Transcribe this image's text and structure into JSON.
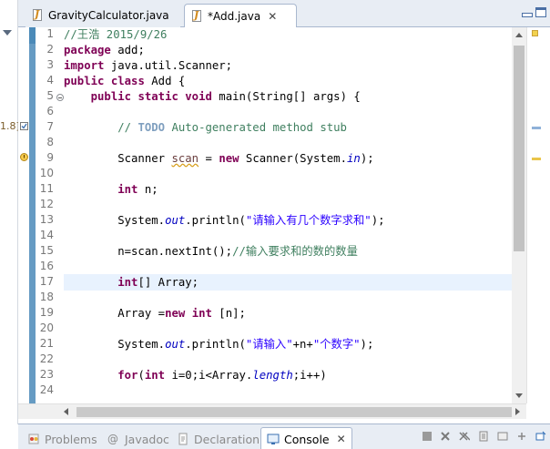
{
  "editor_tabs": [
    {
      "label": "GravityCalculator.java",
      "active": false
    },
    {
      "label": "*Add.java",
      "active": true
    }
  ],
  "left_fragment": "1.8]",
  "code_lines": [
    {
      "n": "1",
      "tokens": [
        {
          "t": "//王浩 2015/9/26",
          "c": "cm"
        }
      ]
    },
    {
      "n": "2",
      "tokens": [
        {
          "t": "package",
          "c": "kw"
        },
        {
          "t": " add;",
          "c": "var"
        }
      ]
    },
    {
      "n": "3",
      "tokens": [
        {
          "t": "import",
          "c": "kw"
        },
        {
          "t": " java.util.Scanner;",
          "c": "var"
        }
      ]
    },
    {
      "n": "4",
      "tokens": [
        {
          "t": "public",
          "c": "kw"
        },
        {
          "t": " ",
          "c": "var"
        },
        {
          "t": "class",
          "c": "kw"
        },
        {
          "t": " Add {",
          "c": "var"
        }
      ]
    },
    {
      "n": "5",
      "tokens": [
        {
          "t": "    ",
          "c": "var"
        },
        {
          "t": "public",
          "c": "kw"
        },
        {
          "t": " ",
          "c": "var"
        },
        {
          "t": "static",
          "c": "kw"
        },
        {
          "t": " ",
          "c": "var"
        },
        {
          "t": "void",
          "c": "kw"
        },
        {
          "t": " main(String[] args) {",
          "c": "var"
        }
      ]
    },
    {
      "n": "6",
      "tokens": []
    },
    {
      "n": "7",
      "tokens": [
        {
          "t": "        // ",
          "c": "cm"
        },
        {
          "t": "TODO",
          "c": "todo"
        },
        {
          "t": " Auto-generated method stub",
          "c": "cm"
        }
      ]
    },
    {
      "n": "8",
      "tokens": []
    },
    {
      "n": "9",
      "tokens": [
        {
          "t": "        Scanner ",
          "c": "var"
        },
        {
          "t": "scan",
          "c": "unused"
        },
        {
          "t": " = ",
          "c": "var"
        },
        {
          "t": "new",
          "c": "kw"
        },
        {
          "t": " Scanner(System.",
          "c": "var"
        },
        {
          "t": "in",
          "c": "fld"
        },
        {
          "t": ");",
          "c": "var"
        }
      ]
    },
    {
      "n": "10",
      "tokens": []
    },
    {
      "n": "11",
      "tokens": [
        {
          "t": "        ",
          "c": "var"
        },
        {
          "t": "int",
          "c": "kw"
        },
        {
          "t": " n;",
          "c": "var"
        }
      ]
    },
    {
      "n": "12",
      "tokens": []
    },
    {
      "n": "13",
      "tokens": [
        {
          "t": "        System.",
          "c": "var"
        },
        {
          "t": "out",
          "c": "fld"
        },
        {
          "t": ".println(",
          "c": "var"
        },
        {
          "t": "\"请输入有几个数字求和\"",
          "c": "st"
        },
        {
          "t": ");",
          "c": "var"
        }
      ]
    },
    {
      "n": "14",
      "tokens": []
    },
    {
      "n": "15",
      "tokens": [
        {
          "t": "        n=scan.nextInt();",
          "c": "var"
        },
        {
          "t": "//输入要求和的数的数量",
          "c": "cm"
        }
      ]
    },
    {
      "n": "16",
      "tokens": []
    },
    {
      "n": "17",
      "tokens": [
        {
          "t": "        ",
          "c": "var"
        },
        {
          "t": "int",
          "c": "kw"
        },
        {
          "t": "[] Array;",
          "c": "var"
        }
      ]
    },
    {
      "n": "18",
      "tokens": []
    },
    {
      "n": "19",
      "tokens": [
        {
          "t": "        Array =",
          "c": "var"
        },
        {
          "t": "new",
          "c": "kw"
        },
        {
          "t": " ",
          "c": "var"
        },
        {
          "t": "int",
          "c": "kw"
        },
        {
          "t": " [n];",
          "c": "var"
        }
      ]
    },
    {
      "n": "20",
      "tokens": []
    },
    {
      "n": "21",
      "tokens": [
        {
          "t": "        System.",
          "c": "var"
        },
        {
          "t": "out",
          "c": "fld"
        },
        {
          "t": ".println(",
          "c": "var"
        },
        {
          "t": "\"请输入\"",
          "c": "st"
        },
        {
          "t": "+n+",
          "c": "var"
        },
        {
          "t": "\"个数字\"",
          "c": "st"
        },
        {
          "t": ");",
          "c": "var"
        }
      ]
    },
    {
      "n": "22",
      "tokens": []
    },
    {
      "n": "23",
      "tokens": [
        {
          "t": "        ",
          "c": "var"
        },
        {
          "t": "for",
          "c": "kw"
        },
        {
          "t": "(",
          "c": "var"
        },
        {
          "t": "int",
          "c": "kw"
        },
        {
          "t": " i=0;i<Array.",
          "c": "var"
        },
        {
          "t": "length",
          "c": "fld"
        },
        {
          "t": ";i++)",
          "c": "var"
        }
      ]
    },
    {
      "n": "24",
      "tokens": []
    }
  ],
  "bottom_tabs": [
    {
      "label": "Problems",
      "active": false,
      "icon": "problems-icon"
    },
    {
      "label": "Javadoc",
      "active": false,
      "icon": "javadoc-icon"
    },
    {
      "label": "Declaration",
      "active": false,
      "icon": "declaration-icon"
    },
    {
      "label": "Console",
      "active": true,
      "icon": "console-icon"
    }
  ],
  "console_toolbar_icons": [
    "terminate-icon",
    "remove-launch-icon",
    "remove-all-icon",
    "scroll-lock-icon",
    "pin-console-icon",
    "display-console-icon",
    "open-console-icon"
  ],
  "colors": {
    "keyword": "#7f0055",
    "comment": "#3f7f5f",
    "string": "#2a00ff",
    "field": "#0000c0",
    "current_line": "#e8f2fe",
    "change_bar": "#4b8ab8"
  }
}
